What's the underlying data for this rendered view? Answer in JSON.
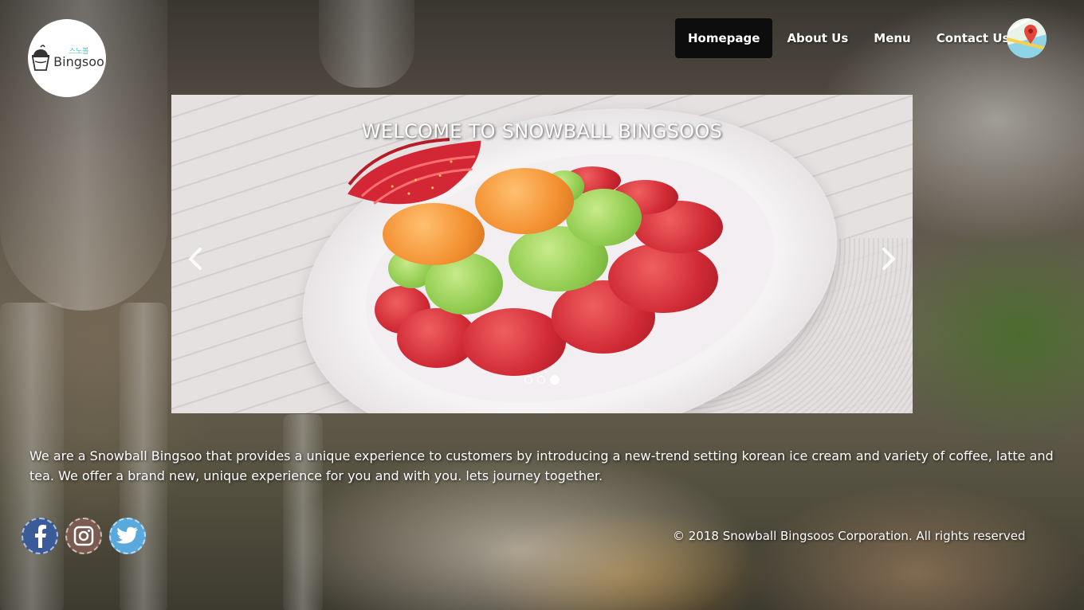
{
  "logo": {
    "korean": "스노볼",
    "name": "Bingsoo",
    "icon": "bingsoo-cup-icon"
  },
  "nav": {
    "items": [
      {
        "label": "Homepage",
        "active": true
      },
      {
        "label": "About Us",
        "active": false
      },
      {
        "label": "Menu",
        "active": false
      },
      {
        "label": "Contact Us",
        "active": false
      }
    ],
    "map_icon": "map-pin-icon"
  },
  "carousel": {
    "title": "WELCOME TO SNOWBALL BINGSOOS",
    "prev_icon": "chevron-left-icon",
    "next_icon": "chevron-right-icon",
    "slide_count": 3,
    "active_slide": 3
  },
  "about": {
    "text": "We are a Snowball Bingsoo that provides a unique experience to customers by introducing a new-trend setting korean ice cream and variety of coffee, latte and tea. We offer a brand new, unique experience for you and with you. lets journey together."
  },
  "social": [
    {
      "name": "facebook-icon",
      "glyph": "f"
    },
    {
      "name": "instagram-icon",
      "glyph": ""
    },
    {
      "name": "twitter-icon",
      "glyph": ""
    }
  ],
  "footer": {
    "copyright": "© 2018 Snowball Bingsoos Corporation. All rights reserved"
  },
  "colors": {
    "nav_active_bg": "#0d0d0d",
    "text": "#ffffff",
    "facebook": "#3b5b98",
    "instagram": "#7b5a50",
    "twitter": "#5aa9dc"
  }
}
